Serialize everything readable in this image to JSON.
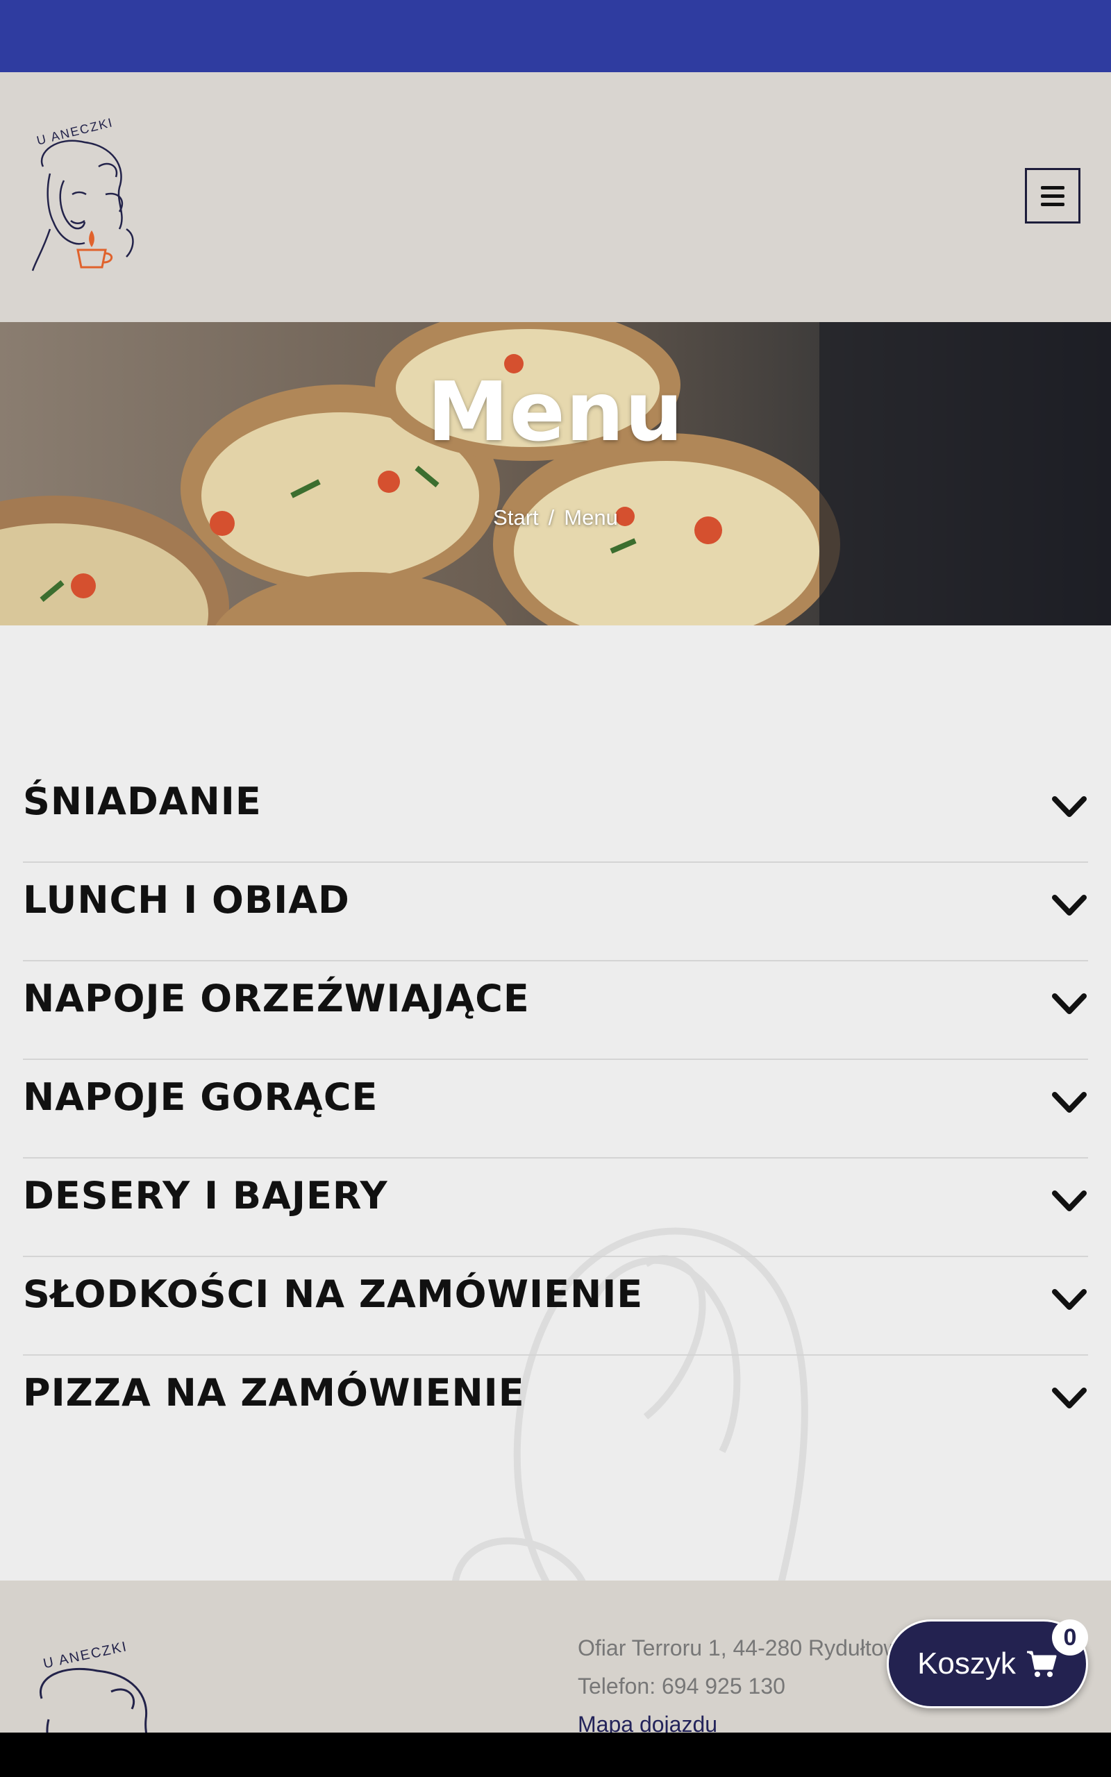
{
  "header": {
    "logo_text": "U ANECZKI",
    "menu_icon": "hamburger-icon"
  },
  "hero": {
    "title": "Menu",
    "breadcrumb": {
      "start": "Start",
      "separator": "/",
      "current": "Menu"
    }
  },
  "menu": {
    "categories": [
      {
        "label": "ŚNIADANIE"
      },
      {
        "label": "LUNCH I OBIAD"
      },
      {
        "label": "NAPOJE ORZEŹWIAJĄCE"
      },
      {
        "label": "NAPOJE GORĄCE"
      },
      {
        "label": "DESERY I BAJERY"
      },
      {
        "label": "SŁODKOŚCI NA ZAMÓWIENIE"
      },
      {
        "label": "PIZZA NA ZAMÓWIENIE"
      }
    ]
  },
  "footer": {
    "address": "Ofiar Terroru 1, 44-280 Rydułtowy",
    "phone": "Telefon: 694 925 130",
    "map_link": "Mapa dojazdu"
  },
  "cart": {
    "label": "Koszyk",
    "count": "0",
    "icon": "cart-icon"
  },
  "colors": {
    "topbar": "#2f3ca0",
    "header_bg": "#d9d5d0",
    "cart_bg": "#232250",
    "accent_orange": "#e0622c"
  }
}
